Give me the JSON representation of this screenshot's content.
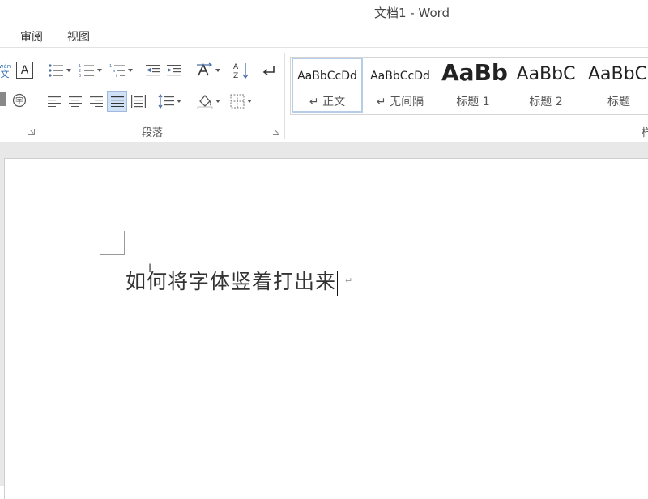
{
  "window": {
    "title": "文档1 - Word"
  },
  "menu": {
    "tabs": [
      "审阅",
      "视图"
    ]
  },
  "ribbon": {
    "paragraph_group_label": "段落",
    "styles_group_label_partial": "样",
    "phonetic_glyph_top": "wén",
    "phonetic_glyph_bottom": "文",
    "font_glyph": "A",
    "styles": [
      {
        "sample": "AaBbCcDd",
        "name": "↵ 正文",
        "selected": true
      },
      {
        "sample": "AaBbCcDd",
        "name": "↵ 无间隔",
        "selected": false
      },
      {
        "sample": "AaBb",
        "name": "标题 1",
        "selected": false
      },
      {
        "sample": "AaBbC",
        "name": "标题 2",
        "selected": false
      },
      {
        "sample": "AaBbC",
        "name": "标题",
        "selected": false
      }
    ]
  },
  "document": {
    "text": "如何将字体竖着打出来",
    "return_mark": "↵"
  },
  "colors": {
    "ribbon_active": "#cfe0f7",
    "gallery_selected": "#b5cdea"
  },
  "icons": [
    "bullets-icon",
    "numbering-icon",
    "multilevel-list-icon",
    "decrease-indent-icon",
    "increase-indent-icon",
    "text-direction-icon",
    "sort-icon",
    "show-marks-icon",
    "align-left-icon",
    "align-center-icon",
    "align-right-icon",
    "justify-icon",
    "distributed-icon",
    "line-spacing-icon",
    "shading-icon",
    "borders-icon",
    "enclose-char-icon"
  ]
}
